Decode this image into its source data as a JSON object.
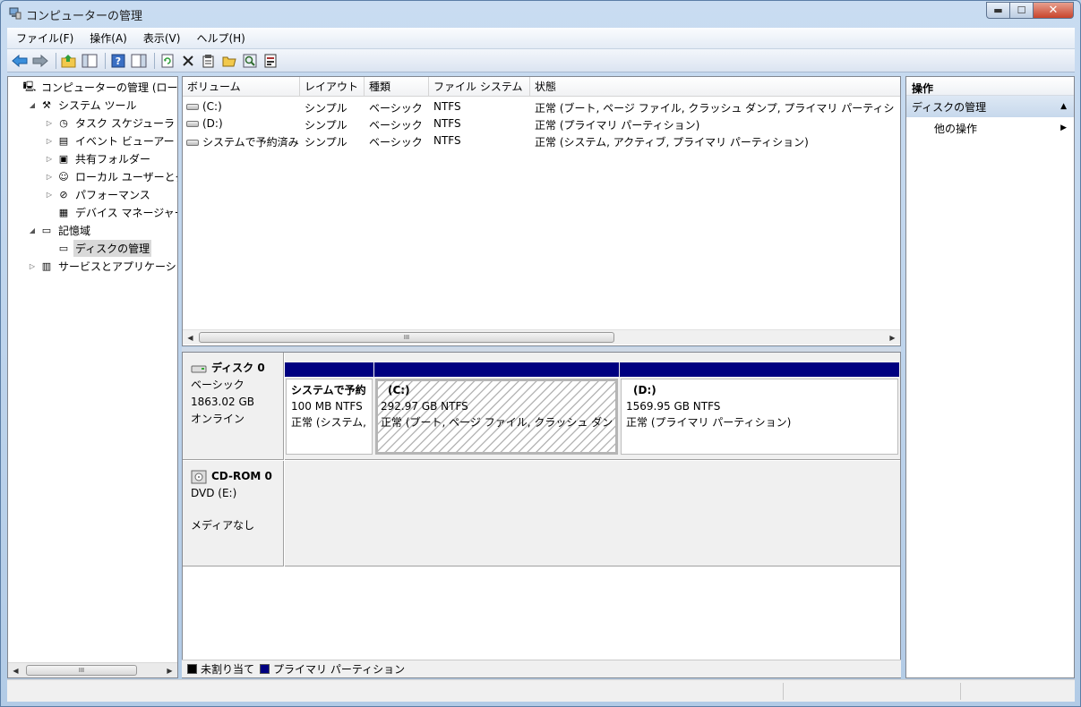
{
  "window": {
    "title": "コンピューターの管理"
  },
  "menu": [
    "ファイル(F)",
    "操作(A)",
    "表示(V)",
    "ヘルプ(H)"
  ],
  "toolbar": {
    "icons": [
      "back-arrow-icon",
      "forward-arrow-icon",
      "up-folder-icon",
      "show-hide-tree-icon",
      "help-icon",
      "show-hide-action-pane-icon",
      "refresh-icon",
      "delete-icon",
      "properties-icon",
      "open-icon",
      "search-icon",
      "export-icon"
    ]
  },
  "tree": {
    "items": [
      {
        "label": "コンピューターの管理 (ローカ",
        "level": 0,
        "expander": "",
        "icon": "computer-management-icon"
      },
      {
        "label": "システム ツール",
        "level": 1,
        "expander": "◢",
        "icon": "system-tools-icon"
      },
      {
        "label": "タスク スケジューラ",
        "level": 2,
        "expander": "▷",
        "icon": "clock-icon"
      },
      {
        "label": "イベント ビューアー",
        "level": 2,
        "expander": "▷",
        "icon": "event-viewer-icon"
      },
      {
        "label": "共有フォルダー",
        "level": 2,
        "expander": "▷",
        "icon": "shared-folder-icon"
      },
      {
        "label": "ローカル ユーザーとグ",
        "level": 2,
        "expander": "▷",
        "icon": "users-icon"
      },
      {
        "label": "パフォーマンス",
        "level": 2,
        "expander": "▷",
        "icon": "performance-icon"
      },
      {
        "label": "デバイス マネージャー",
        "level": 2,
        "expander": "",
        "icon": "device-manager-icon"
      },
      {
        "label": "記憶域",
        "level": 1,
        "expander": "◢",
        "icon": "storage-icon"
      },
      {
        "label": "ディスクの管理",
        "level": 2,
        "expander": "",
        "icon": "disk-management-icon",
        "selected": true
      },
      {
        "label": "サービスとアプリケーショ",
        "level": 1,
        "expander": "▷",
        "icon": "services-icon"
      }
    ]
  },
  "volumes": {
    "columns": [
      "ボリューム",
      "レイアウト",
      "種類",
      "ファイル システム",
      "状態"
    ],
    "rows": [
      [
        "(C:)",
        "シンプル",
        "ベーシック",
        "NTFS",
        "正常 (ブート, ページ ファイル, クラッシュ ダンプ, プライマリ パーティシ"
      ],
      [
        "(D:)",
        "シンプル",
        "ベーシック",
        "NTFS",
        "正常 (プライマリ パーティション)"
      ],
      [
        "システムで予約済み",
        "シンプル",
        "ベーシック",
        "NTFS",
        "正常 (システム, アクティブ, プライマリ パーティション)"
      ]
    ],
    "scroll_thumb_label": "III"
  },
  "disks": {
    "disk0": {
      "name": "ディスク 0",
      "type": "ベーシック",
      "size": "1863.02 GB",
      "status": "オンライン",
      "partitions": [
        {
          "name": "システムで予約",
          "size": "100 MB NTFS",
          "status": "正常 (システム,"
        },
        {
          "name": "(C:)",
          "size": "292.97 GB NTFS",
          "status": "正常 (ブート, ページ ファイル, クラッシュ ダン"
        },
        {
          "name": "(D:)",
          "size": "1569.95 GB NTFS",
          "status": "正常 (プライマリ パーティション)"
        }
      ]
    },
    "cdrom0": {
      "name": "CD-ROM 0",
      "type": "DVD (E:)",
      "status": "メディアなし"
    }
  },
  "legend": {
    "items": [
      {
        "label": "未割り当て",
        "color": "#000000"
      },
      {
        "label": "プライマリ パーティション",
        "color": "#000080"
      }
    ]
  },
  "actions": {
    "title": "操作",
    "section": "ディスクの管理",
    "item": "他の操作"
  },
  "tree_scroll_thumb_label": "III"
}
